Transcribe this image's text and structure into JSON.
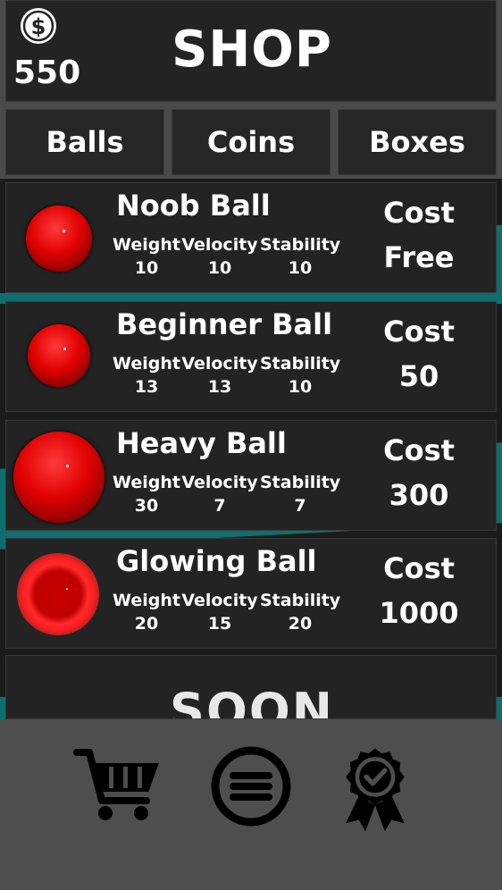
{
  "header": {
    "title": "SHOP",
    "coin_count": "550",
    "coin_symbol": "$"
  },
  "tabs": [
    {
      "label": "Balls"
    },
    {
      "label": "Coins"
    },
    {
      "label": "Boxes"
    }
  ],
  "stat_labels": {
    "weight": "Weight",
    "velocity": "Velocity",
    "stability": "Stability"
  },
  "cost_label": "Cost",
  "items": [
    {
      "name": "Noob Ball",
      "weight": "10",
      "velocity": "10",
      "stability": "10",
      "cost": "Free"
    },
    {
      "name": "Beginner Ball",
      "weight": "13",
      "velocity": "13",
      "stability": "10",
      "cost": "50"
    },
    {
      "name": "Heavy Ball",
      "weight": "30",
      "velocity": "7",
      "stability": "7",
      "cost": "300"
    },
    {
      "name": "Glowing Ball",
      "weight": "20",
      "velocity": "15",
      "stability": "20",
      "cost": "1000"
    }
  ],
  "soon_label": "SOON",
  "nav": [
    {
      "icon": "cart-icon"
    },
    {
      "icon": "menu-icon"
    },
    {
      "icon": "award-badge-icon"
    }
  ],
  "colors": {
    "panel": "#232323",
    "ball_red": "#e00000",
    "accent_teal": "#0e6e6e"
  }
}
